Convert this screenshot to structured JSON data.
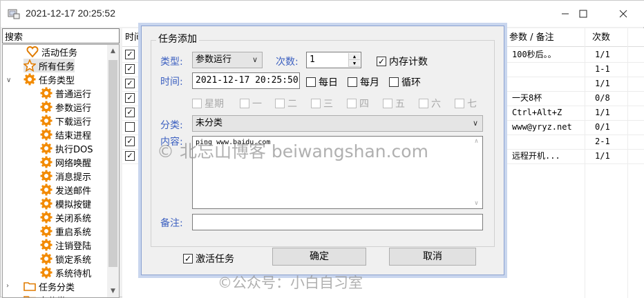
{
  "window": {
    "title": "2021-12-17 20:25:52"
  },
  "search": {
    "label": "搜索"
  },
  "tree": {
    "nodes": [
      {
        "label": "活动任务",
        "icon": "heart-icon"
      },
      {
        "label": "所有任务",
        "icon": "star-icon"
      },
      {
        "label": "任务类型",
        "icon": "gear-icon"
      },
      {
        "label": "普通运行",
        "icon": "gear-icon"
      },
      {
        "label": "参数运行",
        "icon": "gear-icon"
      },
      {
        "label": "下载运行",
        "icon": "gear-icon"
      },
      {
        "label": "结束进程",
        "icon": "gear-icon"
      },
      {
        "label": "执行DOS",
        "icon": "gear-icon"
      },
      {
        "label": "网络唤醒",
        "icon": "gear-icon"
      },
      {
        "label": "消息提示",
        "icon": "gear-icon"
      },
      {
        "label": "发送邮件",
        "icon": "gear-icon"
      },
      {
        "label": "模拟按键",
        "icon": "gear-icon"
      },
      {
        "label": "关闭系统",
        "icon": "gear-icon"
      },
      {
        "label": "重启系统",
        "icon": "gear-icon"
      },
      {
        "label": "注销登陆",
        "icon": "gear-icon"
      },
      {
        "label": "锁定系统",
        "icon": "gear-icon"
      },
      {
        "label": "系统待机",
        "icon": "gear-icon"
      },
      {
        "label": "任务分类",
        "icon": "folder-icon"
      },
      {
        "label": "未分类",
        "icon": "folder-icon"
      }
    ]
  },
  "grid": {
    "col_time": "时间",
    "col_param": "参数 / 备注",
    "col_count": "次数",
    "rows": [
      {
        "checked": true,
        "param": "100秒后。。",
        "count": "1/1"
      },
      {
        "checked": true,
        "param": "",
        "count": "1-1"
      },
      {
        "checked": true,
        "param": "",
        "count": "1/1"
      },
      {
        "checked": true,
        "param": "一天8杯",
        "count": "0/8"
      },
      {
        "checked": true,
        "param": "Ctrl+Alt+Z",
        "count": "1/1"
      },
      {
        "checked": false,
        "param": "www@yryz.net",
        "count": "0/1"
      },
      {
        "checked": true,
        "param": "",
        "count": "2-1"
      },
      {
        "checked": true,
        "param": "远程开机...",
        "count": "1/1"
      }
    ]
  },
  "dialog": {
    "group_title": "任务添加",
    "type_label": "类型:",
    "type_value": "参数运行",
    "count_label": "次数:",
    "count_value": "1",
    "mem_count_label": "内存计数",
    "time_label": "时间:",
    "time_value": "2021-12-17 20:25:50",
    "daily": "每日",
    "monthly": "每月",
    "loop": "循环",
    "weekdays": [
      "星期",
      "一",
      "二",
      "三",
      "四",
      "五",
      "六",
      "七"
    ],
    "category_label": "分类:",
    "category_value": "未分类",
    "content_label": "内容:",
    "content_value": "ping www.baidu.com",
    "note_label": "备注:",
    "note_value": "",
    "activate_label": "激活任务",
    "ok_label": "确定",
    "cancel_label": "取消"
  },
  "watermarks": {
    "main": "© 北忘山博客 beiwangshan.com",
    "bottom": "©公众号：小白自习室"
  }
}
